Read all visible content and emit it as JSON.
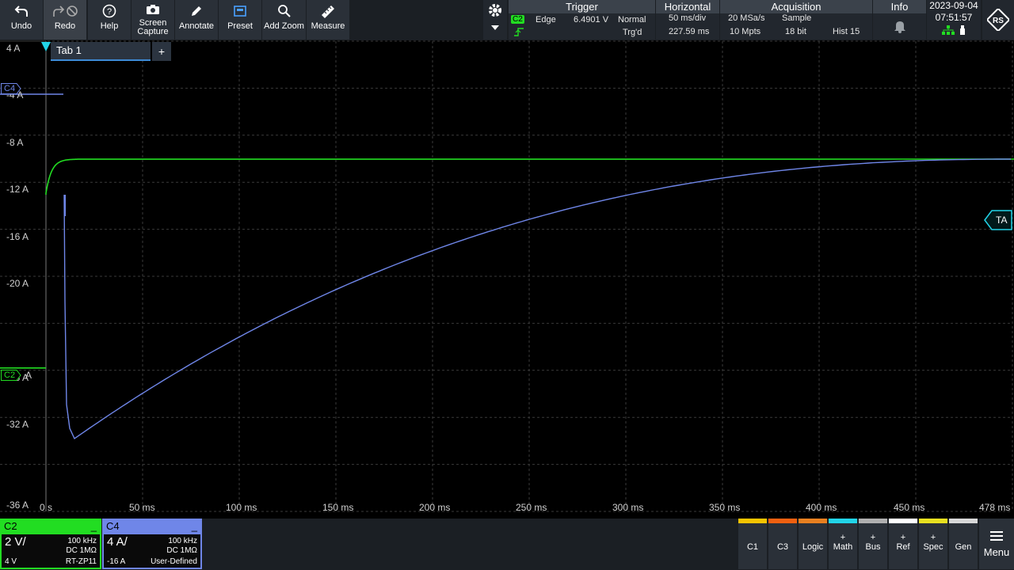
{
  "toolbar": {
    "undo": "Undo",
    "redo": "Redo",
    "help": "Help",
    "screen_capture_1": "Screen",
    "screen_capture_2": "Capture",
    "annotate": "Annotate",
    "preset": "Preset",
    "add_zoom": "Add Zoom",
    "measure": "Measure"
  },
  "trigger": {
    "header": "Trigger",
    "source": "C2",
    "type": "Edge",
    "level": "6.4901 V",
    "mode": "Normal",
    "state": "Trg'd"
  },
  "horizontal": {
    "header": "Horizontal",
    "timebase": "50 ms/div",
    "position": "227.59 ms"
  },
  "acquisition": {
    "header": "Acquisition",
    "sample_rate": "20 MSa/s",
    "mode": "Sample",
    "record_length": "10 Mpts",
    "resolution": "18 bit",
    "history": "Hist 15"
  },
  "info": {
    "header": "Info"
  },
  "datetime": {
    "date": "2023-09-04",
    "time": "07:51:57"
  },
  "tabs": {
    "tab1": "Tab 1",
    "add": "+"
  },
  "y_labels": [
    "4 A",
    "-4 A",
    "-8 A",
    "-12 A",
    "-16 A",
    "-20 A",
    "-28 A",
    "-32 A",
    "-36 A"
  ],
  "x_labels": [
    "0 s",
    "50 ms",
    "100 ms",
    "150 ms",
    "200 ms",
    "250 ms",
    "300 ms",
    "350 ms",
    "400 ms",
    "450 ms",
    "478 ms"
  ],
  "markers": {
    "c4": "C4",
    "c2": "C2",
    "ta": "TA",
    "c2_unit": "A"
  },
  "channels": {
    "c2": {
      "name": "C2",
      "scale": "2 V/",
      "bandwidth": "100 kHz",
      "coupling": "DC 1MΩ",
      "offset": "4 V",
      "probe": "RT-ZP11",
      "color": "#22dd22"
    },
    "c4": {
      "name": "C4",
      "scale": "4 A/",
      "bandwidth": "100 kHz",
      "coupling": "DC 1MΩ",
      "offset": "-16 A",
      "probe": "User-Defined",
      "color": "#6f86e8"
    }
  },
  "bottom_buttons": [
    {
      "label1": "",
      "label2": "C1",
      "color": "#f5c400"
    },
    {
      "label1": "",
      "label2": "C3",
      "color": "#f06010"
    },
    {
      "label1": "",
      "label2": "Logic",
      "color": "#e88020"
    },
    {
      "label1": "+",
      "label2": "Math",
      "color": "#22d4e8"
    },
    {
      "label1": "+",
      "label2": "Bus",
      "color": "#b0b0b0"
    },
    {
      "label1": "+",
      "label2": "Ref",
      "color": "#ffffff"
    },
    {
      "label1": "+",
      "label2": "Spec",
      "color": "#e8e020"
    },
    {
      "label1": "",
      "label2": "Gen",
      "color": "#d8d8d8"
    }
  ],
  "menu": "Menu"
}
